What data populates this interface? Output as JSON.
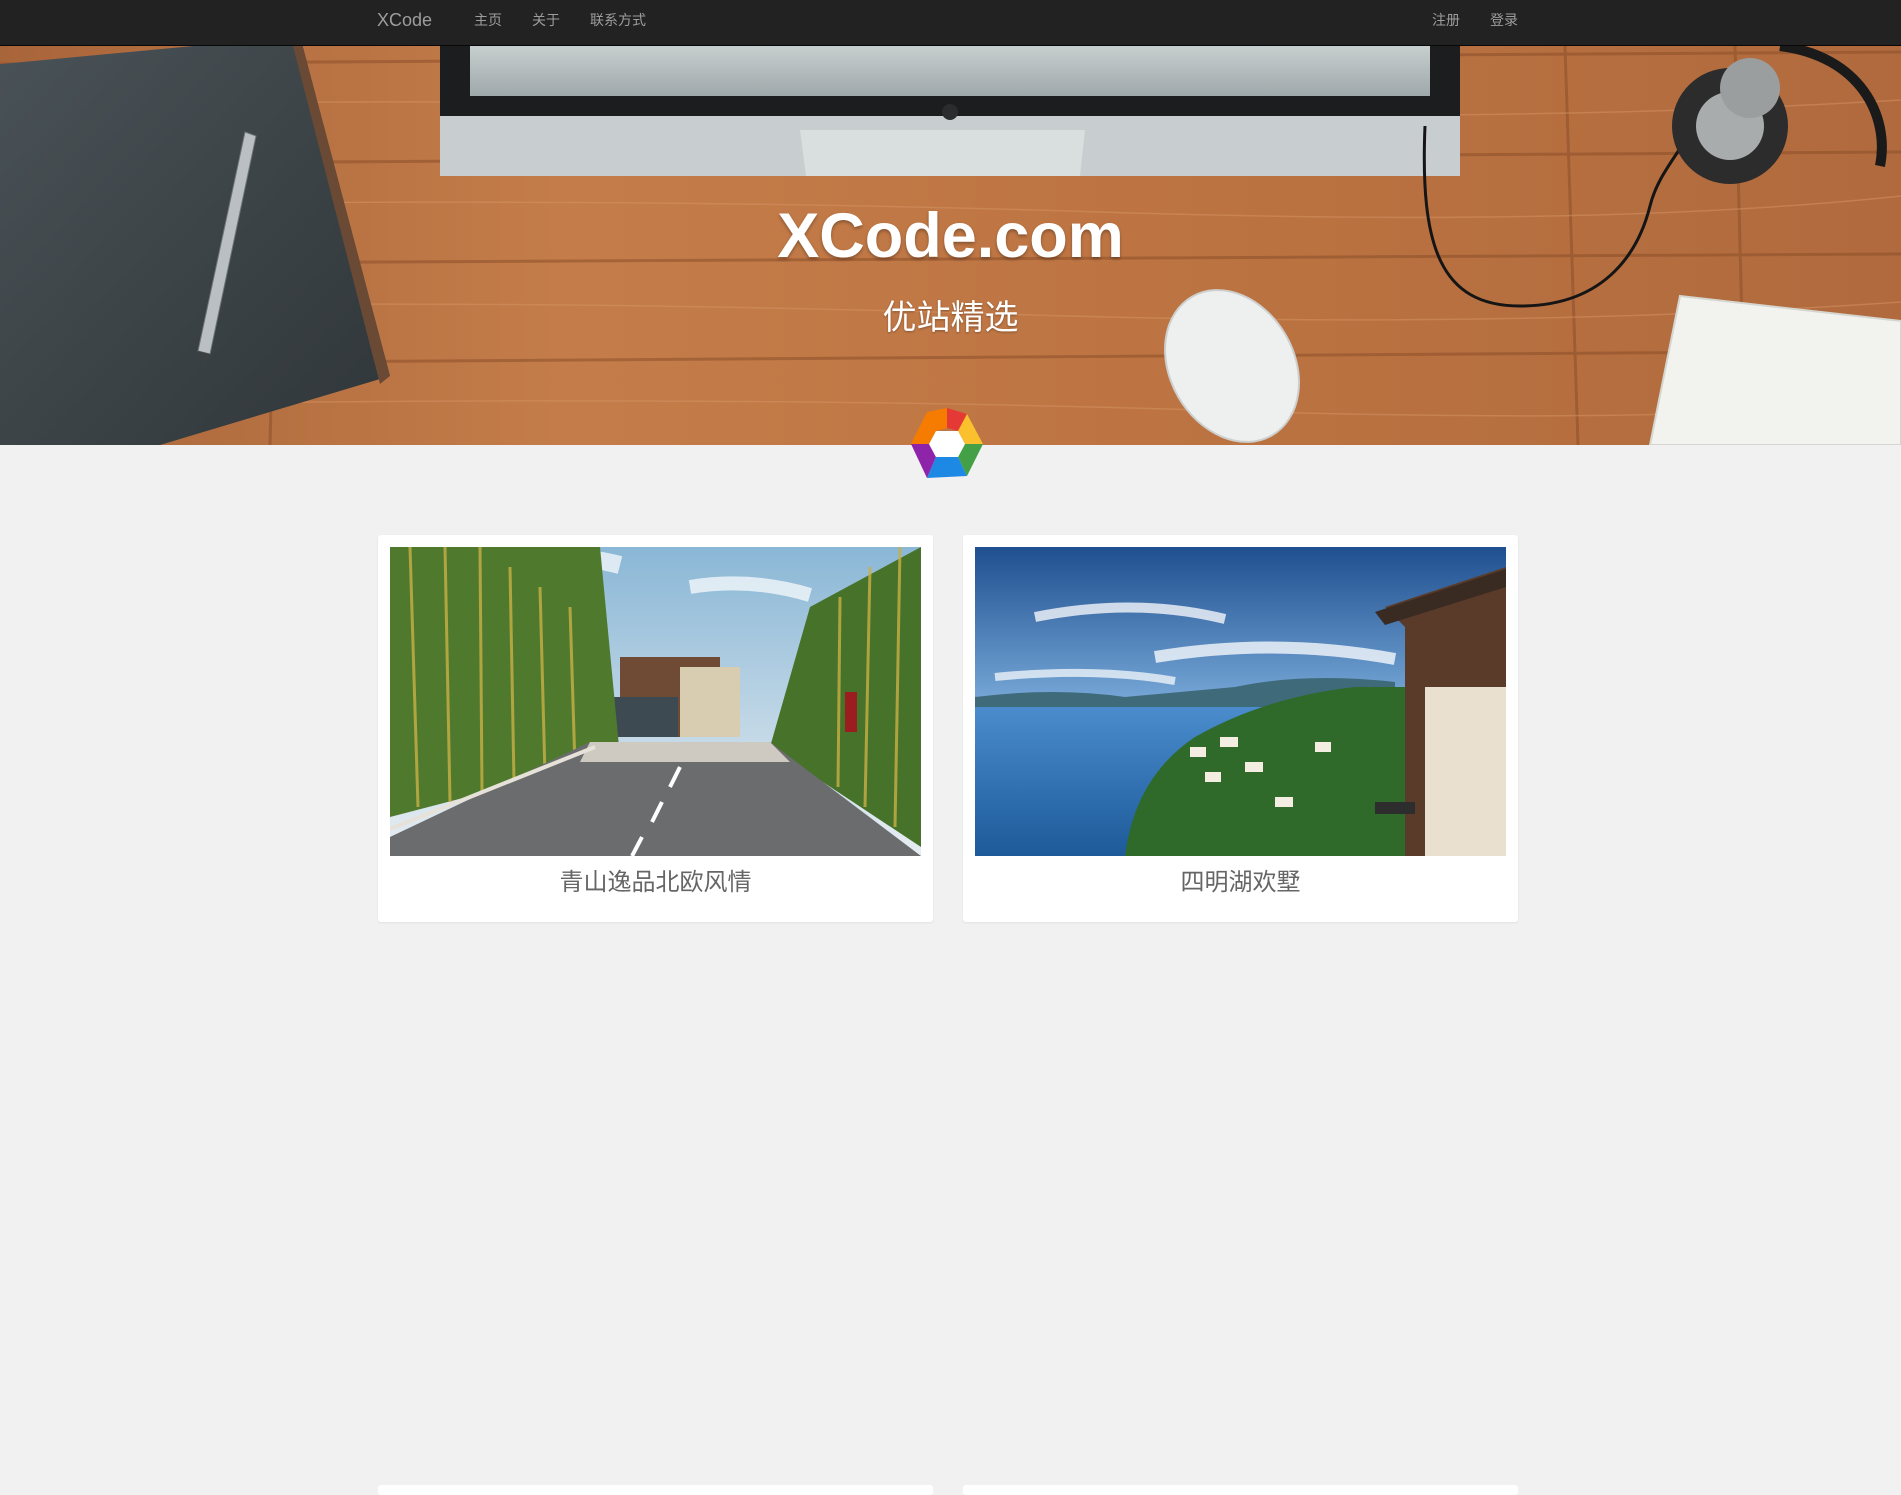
{
  "navbar": {
    "brand": "XCode",
    "links": [
      {
        "label": "主页"
      },
      {
        "label": "关于"
      },
      {
        "label": "联系方式"
      }
    ],
    "right_links": [
      {
        "label": "注册"
      },
      {
        "label": "登录"
      }
    ]
  },
  "hero": {
    "title": "XCode.com",
    "subtitle": "优站精选"
  },
  "logo": {
    "icon": "hexagon-logo-icon",
    "colors": [
      "#e53935",
      "#fbc02d",
      "#43a047",
      "#1e88e5",
      "#8e24aa",
      "#f57c00"
    ]
  },
  "cards": [
    {
      "title": "青山逸品北欧风情",
      "image": "bamboo-road-photo"
    },
    {
      "title": "四明湖欢墅",
      "image": "lake-villa-photo"
    }
  ]
}
